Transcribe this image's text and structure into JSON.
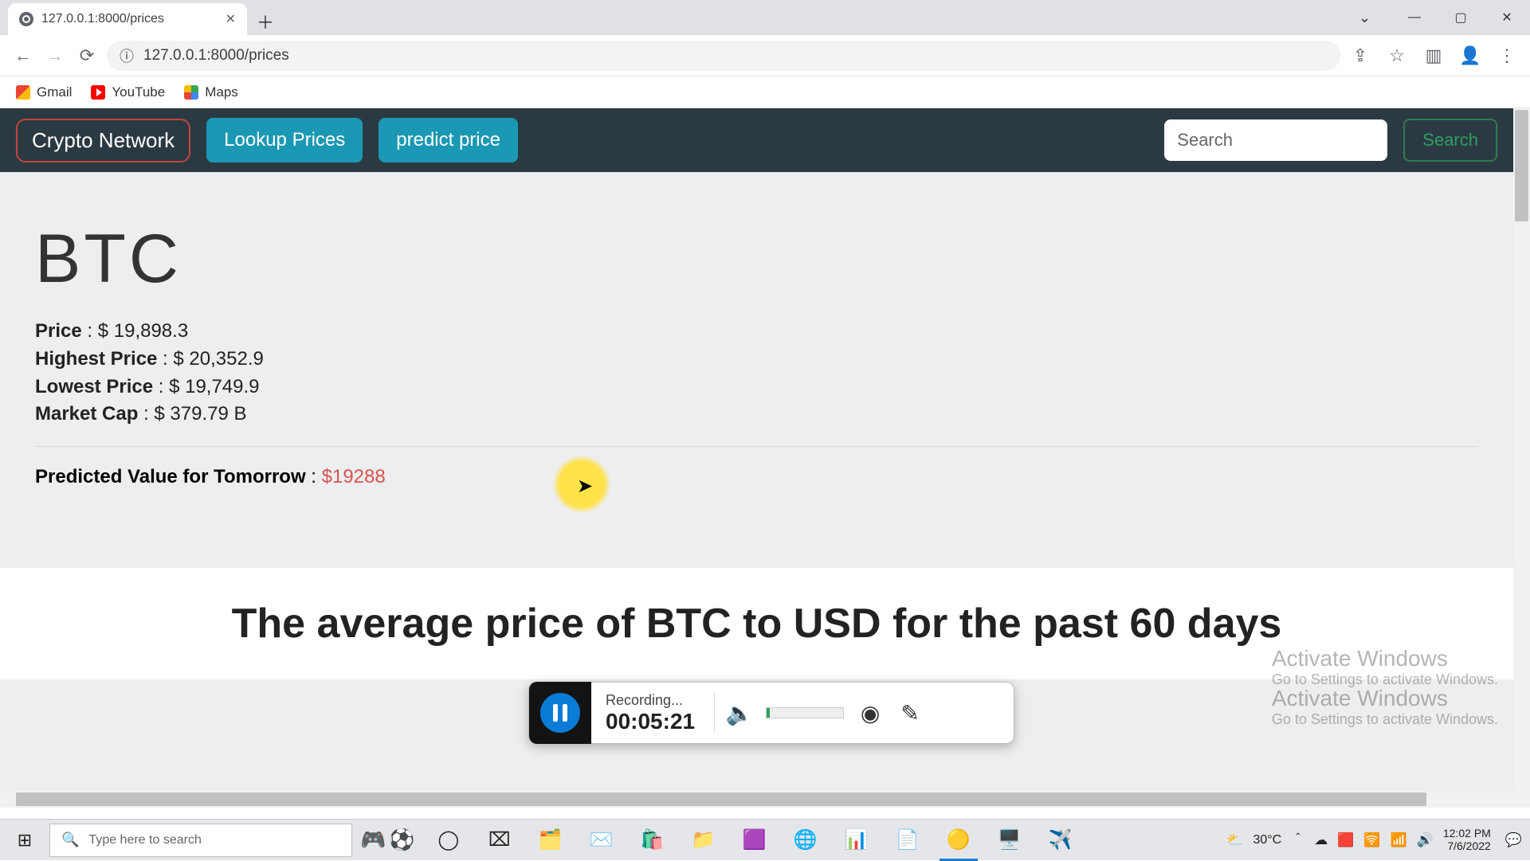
{
  "browser": {
    "tab_title": "127.0.0.1:8000/prices",
    "url": "127.0.0.1:8000/prices",
    "bookmarks": {
      "gmail": "Gmail",
      "youtube": "YouTube",
      "maps": "Maps"
    }
  },
  "nav": {
    "brand": "Crypto Network",
    "lookup": "Lookup Prices",
    "predict": "predict price",
    "search_placeholder": "Search",
    "search_btn": "Search"
  },
  "crypto": {
    "symbol": "BTC",
    "labels": {
      "price": "Price",
      "highest": "Highest Price",
      "lowest": "Lowest Price",
      "mcap": "Market Cap",
      "predicted": "Predicted Value for Tomorrow"
    },
    "price": "$ 19,898.3",
    "highest": "$ 20,352.9",
    "lowest": "$ 19,749.9",
    "mcap": "$ 379.79 B",
    "predicted": "$19288"
  },
  "chart": {
    "title": "The average price of BTC to USD for the past 60 days"
  },
  "recorder": {
    "status": "Recording...",
    "elapsed": "00:05:21"
  },
  "watermark": {
    "title": "Activate Windows",
    "sub": "Go to Settings to activate Windows."
  },
  "taskbar": {
    "search_placeholder": "Type here to search",
    "temp": "30°C",
    "time": "12:02 PM",
    "date": "7/6/2022"
  }
}
